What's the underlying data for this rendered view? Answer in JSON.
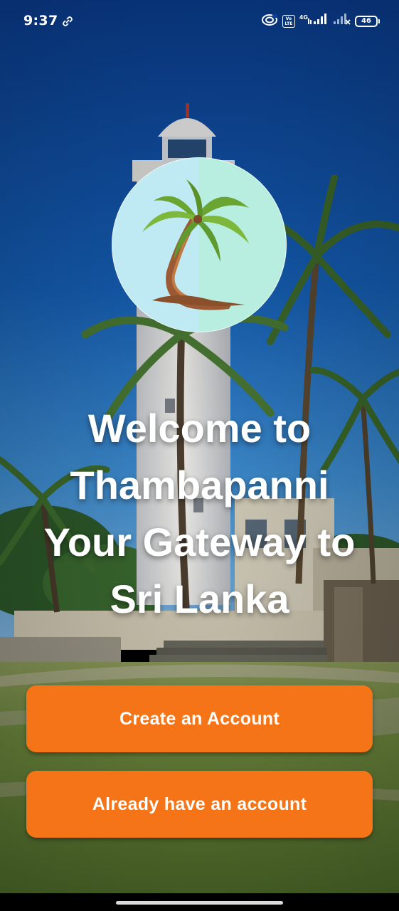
{
  "status_bar": {
    "time": "9:37",
    "volte_top": "Vo",
    "volte_bottom": "LTE",
    "network_type": "4G",
    "battery_level": "46",
    "icons": [
      "link-icon",
      "hotspot-icon",
      "volte-icon",
      "signal-icon",
      "signal-off-icon",
      "battery-icon"
    ]
  },
  "welcome": {
    "lines": [
      "Welcome to",
      "Thambapanni",
      "Your Gateway to",
      "Sri Lanka"
    ]
  },
  "logo": {
    "icon": "palm-tree-icon"
  },
  "buttons": {
    "create_account": "Create an Account",
    "existing_account": "Already have an account"
  },
  "colors": {
    "button_accent": "#f57418",
    "sky": "#0f4fa8",
    "logo_left": "#bfe9f3",
    "logo_right": "#b8eedf"
  }
}
